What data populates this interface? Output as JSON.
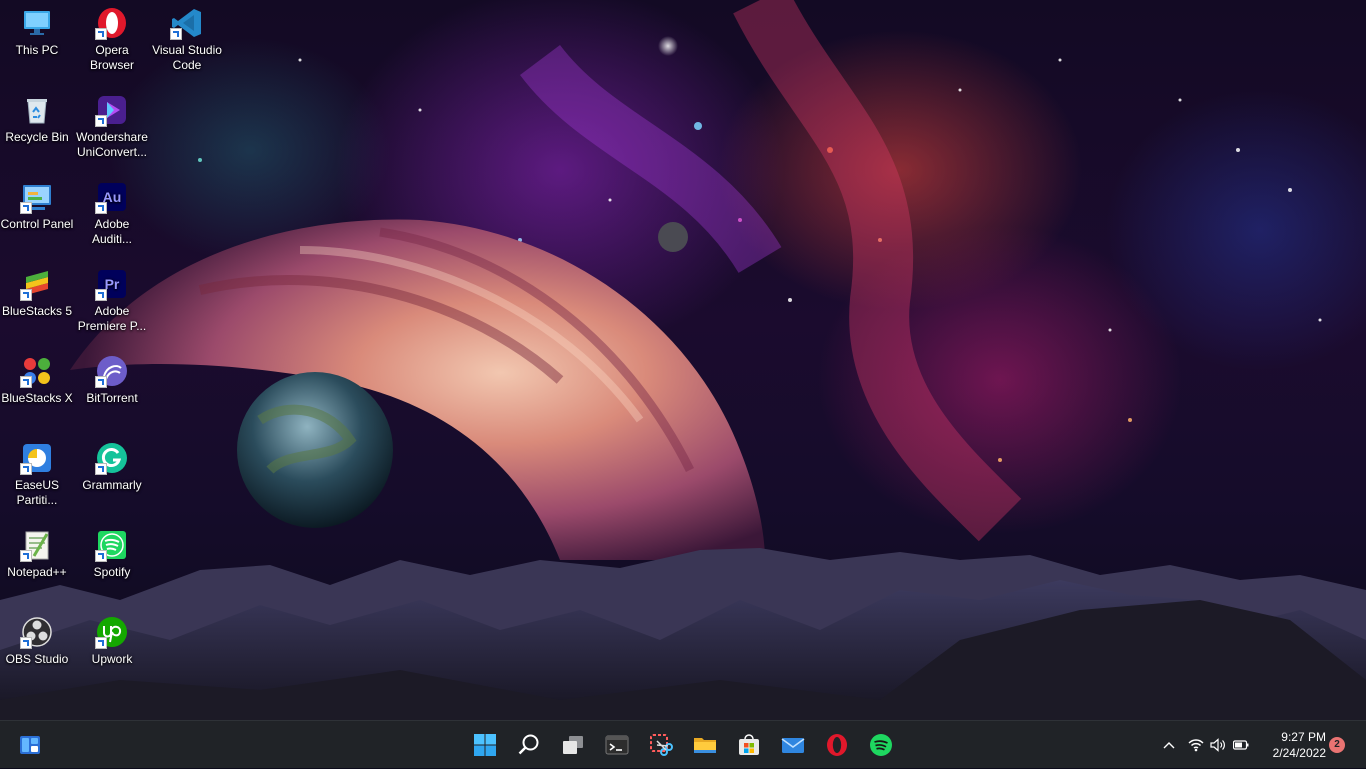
{
  "desktop": {
    "icons": [
      {
        "label": "This PC"
      },
      {
        "label": "Opera Browser"
      },
      {
        "label": "Visual Studio Code"
      },
      {
        "label": "Recycle Bin"
      },
      {
        "label": "Wondershare UniConvert..."
      },
      {
        "label": "Control Panel"
      },
      {
        "label": "Adobe Auditi..."
      },
      {
        "label": "BlueStacks 5"
      },
      {
        "label": "Adobe Premiere P..."
      },
      {
        "label": "BlueStacks X"
      },
      {
        "label": "BitTorrent"
      },
      {
        "label": "EaseUS Partiti..."
      },
      {
        "label": "Grammarly"
      },
      {
        "label": "Notepad++"
      },
      {
        "label": "Spotify"
      },
      {
        "label": "OBS Studio"
      },
      {
        "label": "Upwork"
      }
    ],
    "audition_glyph": "Au",
    "premiere_glyph": "Pr"
  },
  "taskbar": {
    "apps": [
      {
        "icon": "windows-start-icon"
      },
      {
        "icon": "search-icon"
      },
      {
        "icon": "task-view-icon"
      },
      {
        "icon": "terminal-icon"
      },
      {
        "icon": "snipping-tool-icon"
      },
      {
        "icon": "file-explorer-icon"
      },
      {
        "icon": "microsoft-store-icon"
      },
      {
        "icon": "mail-icon"
      },
      {
        "icon": "opera-icon"
      },
      {
        "icon": "spotify-icon"
      }
    ],
    "widgets_icon": "widgets-icon"
  },
  "tray": {
    "time": "9:27 PM",
    "date": "2/24/2022",
    "notification_count": "2",
    "icons": [
      "chevron-up-icon",
      "wifi-icon",
      "volume-icon",
      "battery-icon"
    ]
  },
  "colors": {
    "taskbar": "#202327",
    "accent": "#60cdff",
    "notification_badge": "#e97372"
  }
}
